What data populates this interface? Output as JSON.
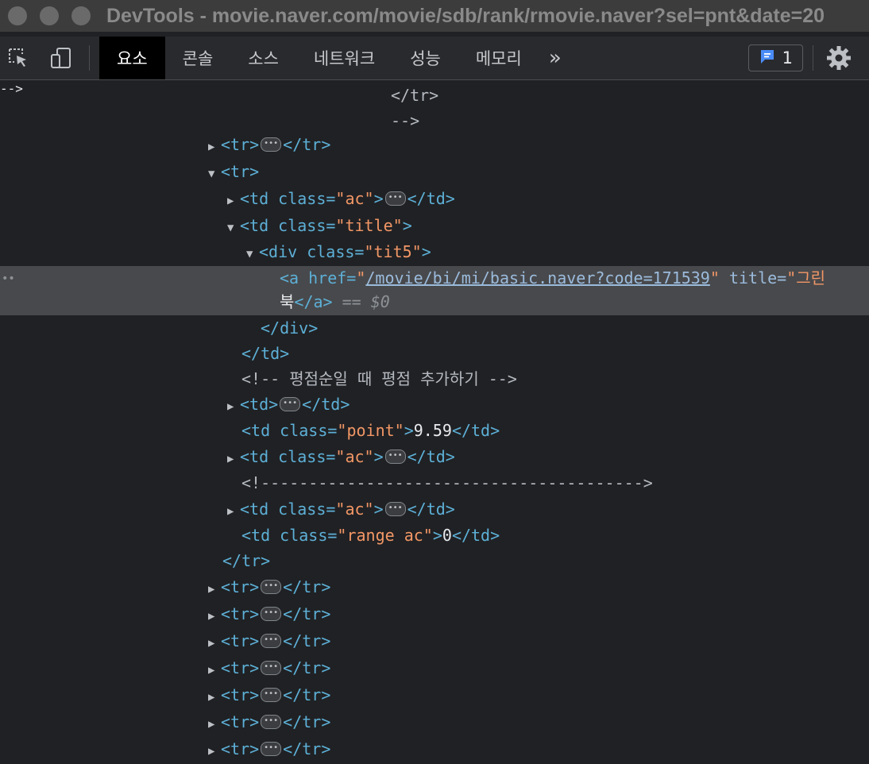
{
  "window": {
    "title": "DevTools - movie.naver.com/movie/sdb/rank/rmovie.naver?sel=pnt&date=20"
  },
  "toolbar": {
    "tabs": [
      "요소",
      "콘솔",
      "소스",
      "네트워크",
      "성능",
      "메모리"
    ],
    "more_label": "»",
    "issues_count": "1"
  },
  "dom": {
    "close_tr": "</tr>",
    "comment_end": "-->",
    "tr_open": "<tr>",
    "tr_close": "</tr>",
    "td_ac_open": "<td class=",
    "ac": "\"ac\"",
    "gt": ">",
    "td_close": "</td>",
    "td_title_class": "\"title\"",
    "div_open": "<div class=",
    "tit5": "\"tit5\"",
    "a_open": "<a href=",
    "a_href": "/movie/bi/mi/basic.naver?code=171539",
    "a_title_attr": "title=",
    "a_title_val": "\"그린",
    "a_text": "북",
    "a_close": "</a>",
    "eq_sel": "== $0",
    "div_close": "</div>",
    "comment_rating": "<!-- 평점순일 때 평점 추가하기  -->",
    "td_open": "<td>",
    "point_class": "\"point\"",
    "point_value": "9.59",
    "comment_long": "<!---------------------------------------->",
    "range_class": "\"range ac\"",
    "range_value": "0"
  }
}
